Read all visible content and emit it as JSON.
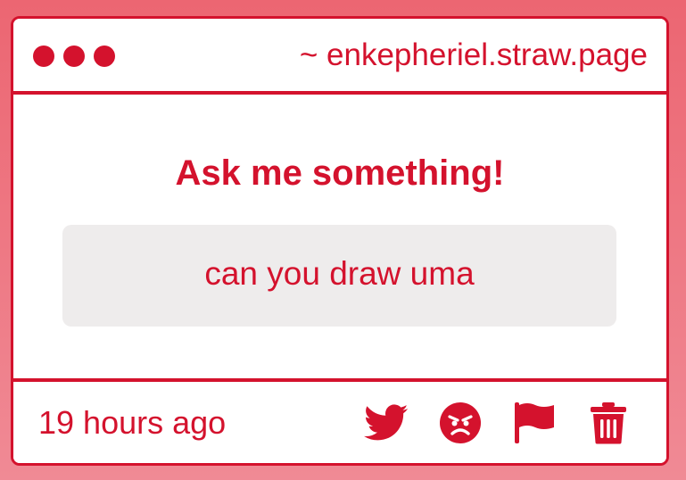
{
  "theme": {
    "accent": "#d4122d",
    "box_background": "#eeecec",
    "page_background_top": "#ec6672",
    "page_background_bottom": "#f08a95"
  },
  "window": {
    "dots": [
      "dot",
      "dot",
      "dot"
    ],
    "url": "~ enkepheriel.straw.page"
  },
  "main": {
    "heading": "Ask me something!",
    "question": "can you draw uma"
  },
  "footer": {
    "timestamp": "19 hours ago",
    "actions": [
      {
        "icon": "twitter-icon"
      },
      {
        "icon": "angry-face-icon"
      },
      {
        "icon": "flag-icon"
      },
      {
        "icon": "trash-icon"
      }
    ]
  }
}
